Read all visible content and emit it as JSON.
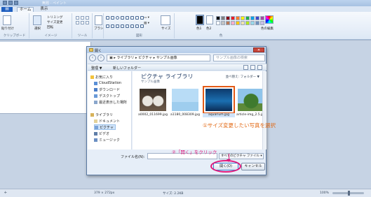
{
  "paint": {
    "title": "無題 - ペイント",
    "tabs": [
      "ホーム",
      "表示"
    ],
    "groups": {
      "clipboard": "クリップボード",
      "image": "イメージ",
      "tools": "ツール",
      "shapes": "図形",
      "colors": "色"
    },
    "ribbon_items": {
      "paste": "貼り付け",
      "select": "選択",
      "crop": "トリミング",
      "resize": "サイズ変更",
      "rotate": "回転",
      "brush": "ブラシ",
      "size": "サイズ",
      "color1": "色1",
      "color2": "色2",
      "edit_colors": "色の編集"
    },
    "palette": [
      "#000000",
      "#7f7f7f",
      "#880015",
      "#ed1c24",
      "#ff7f27",
      "#fff200",
      "#22b14c",
      "#00a2e8",
      "#3f48cc",
      "#a349a4",
      "#ffffff",
      "#c3c3c3",
      "#b97a57",
      "#ffaec9",
      "#ffc90e",
      "#efe4b0",
      "#b5e61d",
      "#99d9ea",
      "#7092be",
      "#c8bfe7"
    ],
    "status": {
      "canvas_size": "379 × 272px",
      "file_size": "サイズ: 2.2KB",
      "zoom": "100%"
    }
  },
  "dialog": {
    "title": "開く",
    "address": [
      "ライブラリ",
      "ピクチャ",
      "サンプル画像"
    ],
    "search_placeholder": "サンプル画像の検索",
    "toolbar": {
      "organize": "整理 ▼",
      "new_folder": "新しいフォルダー"
    },
    "nav": [
      {
        "label": "お気に入り",
        "icon": "star-icon"
      },
      {
        "label": "CloudStation",
        "icon": "cloud-icon"
      },
      {
        "label": "ダウンロード",
        "icon": "download-icon"
      },
      {
        "label": "デスクトップ",
        "icon": "desktop-icon"
      },
      {
        "label": "最近表示した場所",
        "icon": "recent-places-icon"
      },
      {
        "label": "ライブラリ",
        "icon": "library-icon"
      },
      {
        "label": "ドキュメント",
        "icon": "documents-icon"
      },
      {
        "label": "ピクチャ",
        "icon": "pictures-icon"
      },
      {
        "label": "ビデオ",
        "icon": "videos-icon"
      },
      {
        "label": "ミュージック",
        "icon": "music-icon"
      }
    ],
    "library_title": "ピクチャ ライブラリ",
    "library_subtitle": "サンプル画像",
    "arrange": "並べ替え: フォルダー ▼",
    "files": [
      {
        "name": "a0002_011699.jpg",
        "selected": false
      },
      {
        "name": "a1180_008309.jpg",
        "selected": false
      },
      {
        "name": "aquarium.jpg",
        "selected": true
      },
      {
        "name": "article-img_2.5.jpg",
        "selected": false
      }
    ],
    "filename_label": "ファイル名(N):",
    "filetype": "すべてのピクチャ ファイル",
    "open_button": "開く(O)",
    "cancel_button": "キャンセル"
  },
  "annotations": {
    "step1": "①サイズ変更したい写真を選択",
    "step2": "②「開く」をクリック",
    "step1_color": "#e26a16",
    "step2_color": "#e0197b"
  }
}
